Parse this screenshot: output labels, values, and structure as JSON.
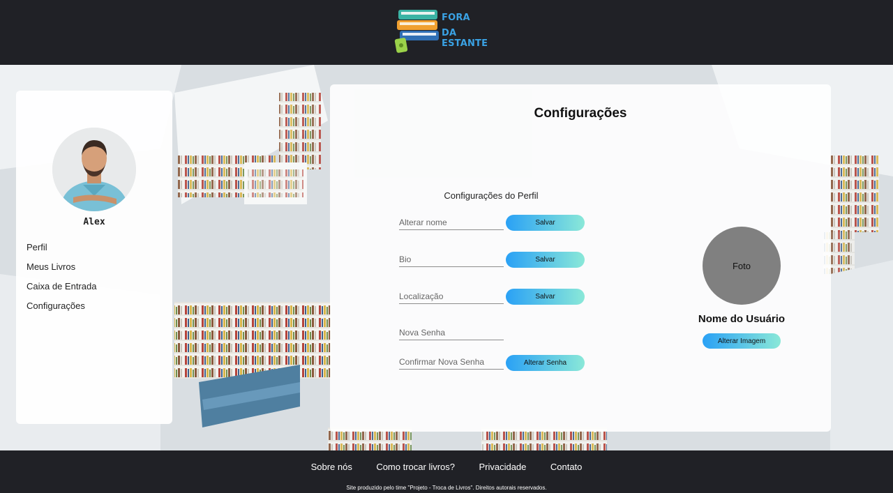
{
  "header": {
    "logo_line1": "FORA",
    "logo_line2": "DA ESTANTE",
    "logo_icon": "stacked-books-icon"
  },
  "sidebar": {
    "user_name": "Alex",
    "avatar_icon": "user-avatar",
    "items": [
      {
        "label": "Perfil"
      },
      {
        "label": "Meus Livros"
      },
      {
        "label": "Caixa de Entrada"
      },
      {
        "label": "Configurações"
      }
    ]
  },
  "settings": {
    "title": "Configurações",
    "section_title": "Configurações do Perfil",
    "fields": {
      "name": {
        "placeholder": "Alterar nome",
        "value": ""
      },
      "bio": {
        "placeholder": "Bio",
        "value": ""
      },
      "location": {
        "placeholder": "Localização",
        "value": ""
      },
      "new_password": {
        "placeholder": "Nova Senha",
        "value": ""
      },
      "confirm_password": {
        "placeholder": "Confirmar Nova Senha",
        "value": ""
      }
    },
    "save_label": "Salvar",
    "change_password_label": "Alterar Senha",
    "photo_label": "Foto",
    "photo_username": "Nome do Usuário",
    "change_image_label": "Alterar Imagem"
  },
  "footer": {
    "links": [
      {
        "label": "Sobre nós"
      },
      {
        "label": "Como trocar livros?"
      },
      {
        "label": "Privacidade"
      },
      {
        "label": "Contato"
      }
    ],
    "copyright": "Site produzido pelo time \"Projeto - Troca de Livros\". Direitos autorais reservados."
  },
  "colors": {
    "dark_bar": "#202126",
    "button_gradient_start": "#2aa1f5",
    "button_gradient_end": "#8ae8d8",
    "logo_blue": "#3aa2e4",
    "photo_placeholder": "#808080"
  }
}
